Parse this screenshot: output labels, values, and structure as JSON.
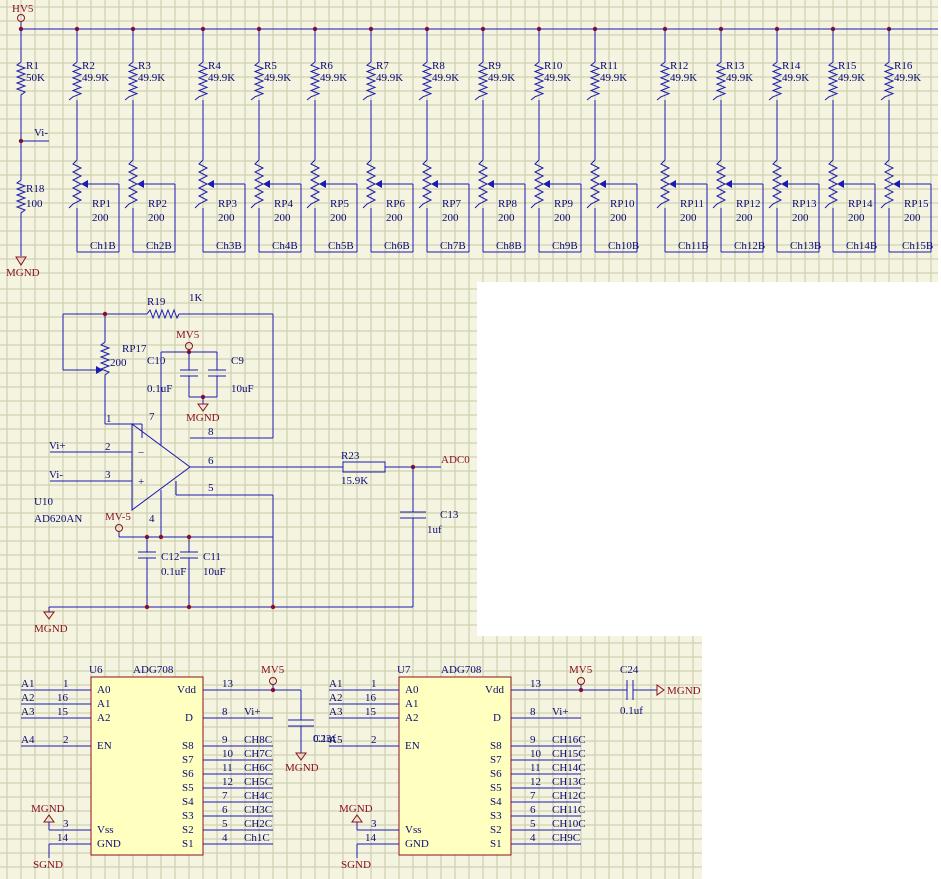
{
  "nets": {
    "hv5": "HV5",
    "mgnd": "MGND",
    "vi_minus": "Vi-",
    "vi_plus": "Vi+",
    "mv5": "MV5",
    "mv_minus5": "MV-5",
    "adc0": "ADC0",
    "sgnd": "SGND"
  },
  "divider": {
    "top": {
      "ref": "R1",
      "value": "50K"
    },
    "bottom": {
      "ref": "R18",
      "value": "100"
    }
  },
  "channel_resistors": [
    {
      "ref": "R2",
      "value": "49.9K"
    },
    {
      "ref": "R3",
      "value": "49.9K"
    },
    {
      "ref": "R4",
      "value": "49.9K"
    },
    {
      "ref": "R5",
      "value": "49.9K"
    },
    {
      "ref": "R6",
      "value": "49.9K"
    },
    {
      "ref": "R7",
      "value": "49.9K"
    },
    {
      "ref": "R8",
      "value": "49.9K"
    },
    {
      "ref": "R9",
      "value": "49.9K"
    },
    {
      "ref": "R10",
      "value": "49.9K"
    },
    {
      "ref": "R11",
      "value": "49.9K"
    },
    {
      "ref": "R12",
      "value": "49.9K"
    },
    {
      "ref": "R13",
      "value": "49.9K"
    },
    {
      "ref": "R14",
      "value": "49.9K"
    },
    {
      "ref": "R15",
      "value": "49.9K"
    },
    {
      "ref": "R16",
      "value": "49.9K"
    }
  ],
  "channel_pots": [
    {
      "ref": "RP1",
      "value": "200",
      "net": "Ch1B"
    },
    {
      "ref": "RP2",
      "value": "200",
      "net": "Ch2B"
    },
    {
      "ref": "RP3",
      "value": "200",
      "net": "Ch3B"
    },
    {
      "ref": "RP4",
      "value": "200",
      "net": "Ch4B"
    },
    {
      "ref": "RP5",
      "value": "200",
      "net": "Ch5B"
    },
    {
      "ref": "RP6",
      "value": "200",
      "net": "Ch6B"
    },
    {
      "ref": "RP7",
      "value": "200",
      "net": "Ch7B"
    },
    {
      "ref": "RP8",
      "value": "200",
      "net": "Ch8B"
    },
    {
      "ref": "RP9",
      "value": "200",
      "net": "Ch9B"
    },
    {
      "ref": "RP10",
      "value": "200",
      "net": "Ch10B"
    },
    {
      "ref": "RP11",
      "value": "200",
      "net": "Ch11B"
    },
    {
      "ref": "RP12",
      "value": "200",
      "net": "Ch12B"
    },
    {
      "ref": "RP13",
      "value": "200",
      "net": "Ch13B"
    },
    {
      "ref": "RP14",
      "value": "200",
      "net": "Ch14B"
    },
    {
      "ref": "RP15",
      "value": "200",
      "net": "Ch15B"
    }
  ],
  "amp": {
    "ref": "U10",
    "part": "AD620AN",
    "gain_res": {
      "ref": "R19",
      "value": "1K"
    },
    "gain_pot": {
      "ref": "RP17",
      "value": "200"
    },
    "out_res": {
      "ref": "R23",
      "value": "15.9K"
    },
    "caps": [
      {
        "ref": "C10",
        "value": "0.1uF"
      },
      {
        "ref": "C9",
        "value": "10uF"
      },
      {
        "ref": "C12",
        "value": "0.1uF"
      },
      {
        "ref": "C11",
        "value": "10uF"
      },
      {
        "ref": "C13",
        "value": "1uf"
      }
    ],
    "pins": [
      "1",
      "2",
      "3",
      "4",
      "5",
      "6",
      "7",
      "8"
    ]
  },
  "muxes": [
    {
      "ref": "U6",
      "part": "ADG708",
      "left": [
        {
          "net": "A1",
          "num": "1",
          "pin": "A0"
        },
        {
          "net": "A2",
          "num": "16",
          "pin": "A1"
        },
        {
          "net": "A3",
          "num": "15",
          "pin": "A2"
        },
        {
          "net": "A4",
          "num": "2",
          "pin": "EN"
        },
        {
          "net": "",
          "num": "3",
          "pin": "Vss"
        },
        {
          "net": "",
          "num": "14",
          "pin": "GND"
        }
      ],
      "right": [
        {
          "pin": "Vdd",
          "num": "13",
          "net": ""
        },
        {
          "pin": "D",
          "num": "8",
          "net": "Vi+"
        },
        {
          "pin": "S8",
          "num": "9",
          "net": "CH8C"
        },
        {
          "pin": "S7",
          "num": "10",
          "net": "CH7C"
        },
        {
          "pin": "S6",
          "num": "11",
          "net": "CH6C"
        },
        {
          "pin": "S5",
          "num": "12",
          "net": "CH5C"
        },
        {
          "pin": "S4",
          "num": "7",
          "net": "CH4C"
        },
        {
          "pin": "S3",
          "num": "6",
          "net": "CH3C"
        },
        {
          "pin": "S2",
          "num": "5",
          "net": "CH2C"
        },
        {
          "pin": "S1",
          "num": "4",
          "net": "Ch1C"
        }
      ],
      "cap": {
        "ref": "C23",
        "value": "0.1uf"
      }
    },
    {
      "ref": "U7",
      "part": "ADG708",
      "left": [
        {
          "net": "A1",
          "num": "1",
          "pin": "A0"
        },
        {
          "net": "A2",
          "num": "16",
          "pin": "A1"
        },
        {
          "net": "A3",
          "num": "15",
          "pin": "A2"
        },
        {
          "net": "A5",
          "num": "2",
          "pin": "EN"
        },
        {
          "net": "",
          "num": "3",
          "pin": "Vss"
        },
        {
          "net": "",
          "num": "14",
          "pin": "GND"
        }
      ],
      "right": [
        {
          "pin": "Vdd",
          "num": "13",
          "net": ""
        },
        {
          "pin": "D",
          "num": "8",
          "net": "Vi+"
        },
        {
          "pin": "S8",
          "num": "9",
          "net": "CH16C"
        },
        {
          "pin": "S7",
          "num": "10",
          "net": "CH15C"
        },
        {
          "pin": "S6",
          "num": "11",
          "net": "CH14C"
        },
        {
          "pin": "S5",
          "num": "12",
          "net": "CH13C"
        },
        {
          "pin": "S4",
          "num": "7",
          "net": "CH12C"
        },
        {
          "pin": "S3",
          "num": "6",
          "net": "CH11C"
        },
        {
          "pin": "S2",
          "num": "5",
          "net": "CH10C"
        },
        {
          "pin": "S1",
          "num": "4",
          "net": "CH9C"
        }
      ],
      "cap": {
        "ref": "C24",
        "value": "0.1uf"
      }
    }
  ],
  "colors": {
    "background": "#f4f4e0",
    "grid": "#c9c9a8",
    "wire": "#1a1ab4",
    "chip_fill": "#ffffc0",
    "net_label": "#8a1020"
  }
}
